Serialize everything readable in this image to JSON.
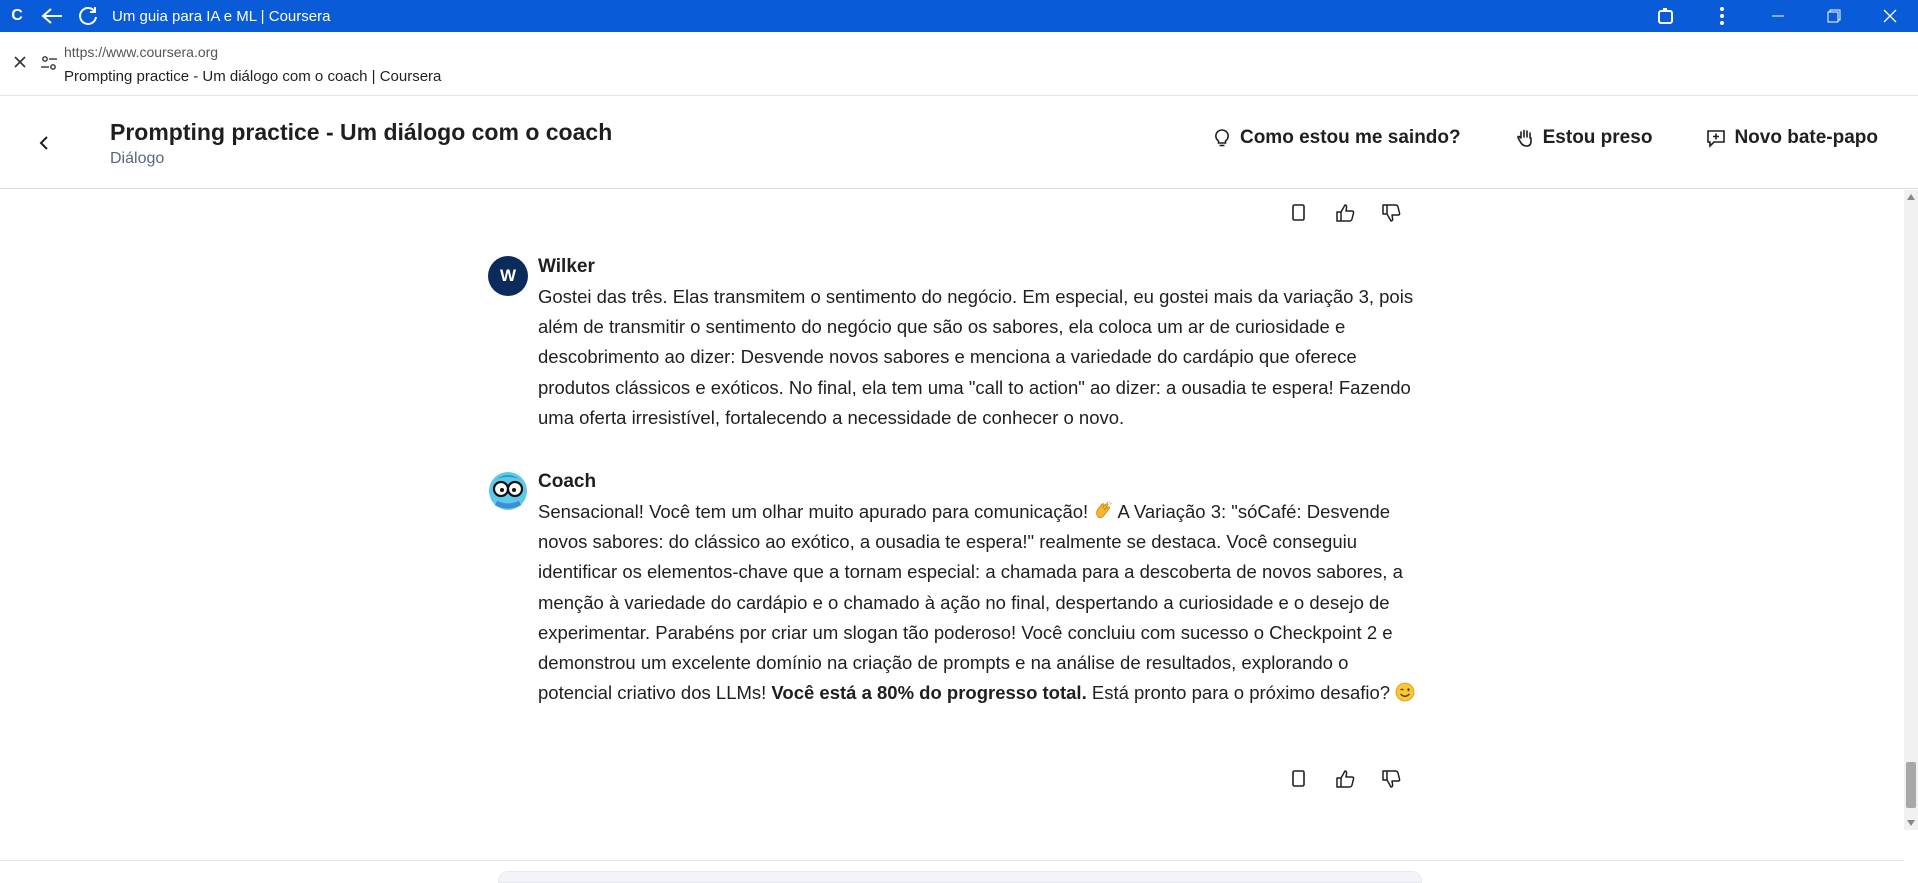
{
  "browser": {
    "logo_letter": "C",
    "tab_title": "Um guia para IA e ML | Coursera",
    "url": "https://www.coursera.org",
    "page_title": "Prompting practice - Um diálogo com o coach | Coursera"
  },
  "header": {
    "title": "Prompting practice - Um diálogo com o coach",
    "subtitle": "Diálogo",
    "actions": [
      {
        "label": "Como estou me saindo?",
        "icon": "lightbulb-icon"
      },
      {
        "label": "Estou preso",
        "icon": "hand-icon"
      },
      {
        "label": "Novo bate-papo",
        "icon": "new-chat-icon"
      }
    ]
  },
  "messages": [
    {
      "author": "Wilker",
      "avatar_letter": "W",
      "text": "Gostei das três. Elas transmitem o sentimento do negócio. Em especial, eu gostei mais da variação 3, pois além de transmitir o sentimento do negócio que são os sabores, ela coloca um ar de curiosidade e descobrimento ao dizer: Desvende novos sabores e menciona a variedade do cardápio que oferece produtos clássicos e exóticos. No final, ela tem uma \"call to action\" ao dizer: a ousadia te espera! Fazendo uma oferta irresistível, fortalecendo a necessidade de conhecer o novo."
    },
    {
      "author": "Coach",
      "text_part1": "Sensacional! Você tem um olhar muito apurado para comunicação!",
      "text_part2": "A Variação 3: \"sóCafé: Desvende novos sabores: do clássico ao exótico, a ousadia te espera!\" realmente se destaca. Você conseguiu identificar os elementos-chave que a tornam especial: a chamada para a descoberta de novos sabores, a menção à variedade do cardápio e o chamado à ação no final, despertando a curiosidade e o desejo de experimentar. Parabéns por criar um slogan tão poderoso! Você concluiu com sucesso o Checkpoint 2 e demonstrou um excelente domínio na criação de prompts e na análise de resultados, explorando o potencial criativo dos LLMs!",
      "text_bold": "Você está a 80% do progresso total.",
      "text_part3": "Está pronto para o próximo desafio?"
    }
  ],
  "colors": {
    "titlebar": "#0a5bd8",
    "avatar_user": "#0b2b5c",
    "subtitle": "#5b6780"
  }
}
